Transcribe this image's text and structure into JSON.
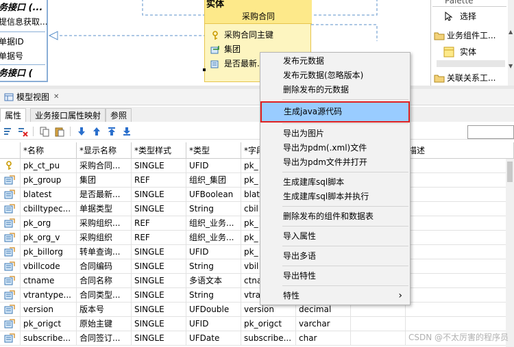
{
  "canvas": {
    "interface": {
      "title": "务接口 (...",
      "line1": "提信息获取...",
      "line2": "单据ID",
      "line3": "单据号",
      "title2": "务接口 ("
    },
    "entity": {
      "title": "实体",
      "subtitle": "采购合同",
      "rows": [
        {
          "label": "采购合同主键",
          "icon": "key-icon"
        },
        {
          "label": "集团",
          "icon": "reference-icon"
        },
        {
          "label": "是否最新...",
          "icon": "field-icon"
        }
      ]
    }
  },
  "palette": {
    "title": "Palette",
    "items": [
      {
        "label": "选择",
        "icon": "select-arrow-icon"
      },
      {
        "label": "业务组件工...",
        "icon": "folder-icon"
      },
      {
        "label": "实体",
        "icon": "entity-icon"
      },
      {
        "label": "关联关系工...",
        "icon": "folder-icon"
      }
    ]
  },
  "view": {
    "tab_label": "模型视图",
    "close_glyph": "✕",
    "subtabs": [
      "属性",
      "业务接口属性映射",
      "参照"
    ]
  },
  "table": {
    "columns": [
      "*名称",
      "*显示名称",
      "*类型样式",
      "*类型",
      "*字段",
      "",
      "",
      "描述"
    ],
    "rows": [
      {
        "icon": "key-icon",
        "name": "pk_ct_pu",
        "display": "采购合同...",
        "style": "SINGLE",
        "type": "UFID",
        "field": "pk_",
        "dbtype": ""
      },
      {
        "icon": "field-icon",
        "name": "pk_group",
        "display": "集团",
        "style": "REF",
        "type": "组织_集团",
        "field": "pk_",
        "dbtype": ""
      },
      {
        "icon": "field-icon",
        "name": "blatest",
        "display": "是否最新...",
        "style": "SINGLE",
        "type": "UFBoolean",
        "field": "blat",
        "dbtype": ""
      },
      {
        "icon": "field-icon",
        "name": "cbilltypec...",
        "display": "单据类型",
        "style": "SINGLE",
        "type": "String",
        "field": "cbil",
        "dbtype": ""
      },
      {
        "icon": "field-icon",
        "name": "pk_org",
        "display": "采购组织...",
        "style": "REF",
        "type": "组织_业务...",
        "field": "pk_",
        "dbtype": ""
      },
      {
        "icon": "field-icon",
        "name": "pk_org_v",
        "display": "采购组织",
        "style": "REF",
        "type": "组织_业务...",
        "field": "pk_",
        "dbtype": ""
      },
      {
        "icon": "field-icon",
        "name": "pk_billorg",
        "display": "转单查询...",
        "style": "SINGLE",
        "type": "UFID",
        "field": "pk_",
        "dbtype": ""
      },
      {
        "icon": "field-icon",
        "name": "vbillcode",
        "display": "合同编码",
        "style": "SINGLE",
        "type": "String",
        "field": "vbil",
        "dbtype": ""
      },
      {
        "icon": "field-icon",
        "name": "ctname",
        "display": "合同名称",
        "style": "SINGLE",
        "type": "多语文本",
        "field": "ctna",
        "dbtype": ""
      },
      {
        "icon": "field-icon",
        "name": "vtrantype...",
        "display": "合同类型...",
        "style": "SINGLE",
        "type": "String",
        "field": "vtra",
        "dbtype": ""
      },
      {
        "icon": "field-icon",
        "name": "version",
        "display": "版本号",
        "style": "SINGLE",
        "type": "UFDouble",
        "field": "version",
        "dbtype": "decimal"
      },
      {
        "icon": "field-icon",
        "name": "pk_origct",
        "display": "原始主键",
        "style": "SINGLE",
        "type": "UFID",
        "field": "pk_origct",
        "dbtype": "varchar"
      },
      {
        "icon": "field-icon",
        "name": "subscribe...",
        "display": "合同签订...",
        "style": "SINGLE",
        "type": "UFDate",
        "field": "subscribe...",
        "dbtype": "char"
      }
    ]
  },
  "context_menu": {
    "items": [
      {
        "label": "发布元数据",
        "kind": "item"
      },
      {
        "label": "发布元数据(忽略版本)",
        "kind": "item"
      },
      {
        "label": "删除发布的元数据",
        "kind": "item"
      },
      {
        "kind": "sep"
      },
      {
        "label": "生成java源代码",
        "kind": "item",
        "highlighted": true
      },
      {
        "kind": "sep"
      },
      {
        "label": "导出为图片",
        "kind": "item"
      },
      {
        "label": "导出为pdm(.xml)文件",
        "kind": "item"
      },
      {
        "label": "导出为pdm文件并打开",
        "kind": "item"
      },
      {
        "kind": "sep"
      },
      {
        "label": "生成建库sql脚本",
        "kind": "item"
      },
      {
        "label": "生成建库sql脚本并执行",
        "kind": "item"
      },
      {
        "kind": "sep"
      },
      {
        "label": "删除发布的组件和数据表",
        "kind": "item"
      },
      {
        "kind": "sep"
      },
      {
        "label": "导入属性",
        "kind": "item"
      },
      {
        "kind": "sep"
      },
      {
        "label": "导出多语",
        "kind": "item"
      },
      {
        "kind": "sep"
      },
      {
        "label": "导出特性",
        "kind": "item"
      },
      {
        "kind": "sep"
      },
      {
        "label": "特性",
        "kind": "submenu",
        "arrow": "›"
      }
    ]
  },
  "watermark": "CSDN @不太厉害的程序员",
  "colors": {
    "highlight": "#99ccff",
    "highlight_border": "#e02020",
    "entity_fill": "#fdf5c0",
    "entity_head": "#fde98a",
    "connector": "#5a8fc9"
  }
}
